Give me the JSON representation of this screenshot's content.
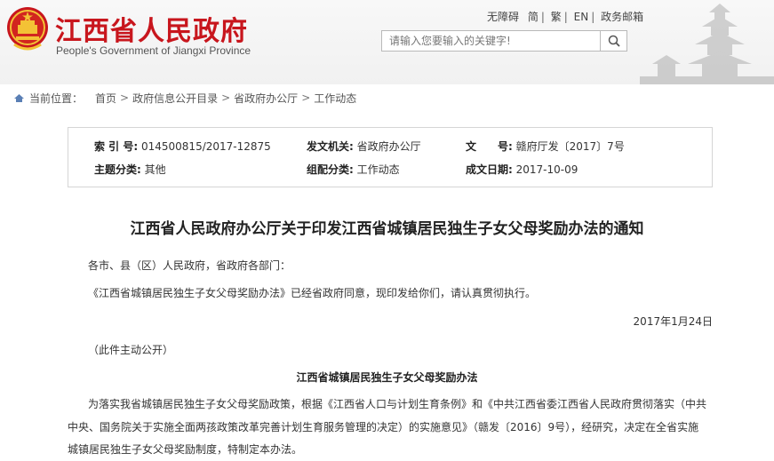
{
  "header": {
    "site_title": "江西省人民政府",
    "site_subtitle": "People's Government of Jiangxi Province",
    "links": [
      "无障碍",
      "简",
      "繁",
      "EN",
      "政务邮箱"
    ],
    "search_placeholder": "请输入您要输入的关键字!"
  },
  "breadcrumb": {
    "label": "当前位置：",
    "items": [
      "首页",
      "政府信息公开目录",
      "省政府办公厅",
      "工作动态"
    ],
    "separator": ">"
  },
  "meta": {
    "index_key": "索 引 号:",
    "index_value": "014500815/2017-12875",
    "issuer_key": "发文机关:",
    "issuer_value": "省政府办公厅",
    "doc_key": "文　　号:",
    "doc_value": "赣府厅发〔2017〕7号",
    "topic_key": "主题分类:",
    "topic_value": "其他",
    "group_key": "组配分类:",
    "group_value": "工作动态",
    "date_key": "成文日期:",
    "date_value": "2017-10-09"
  },
  "article": {
    "title": "江西省人民政府办公厅关于印发江西省城镇居民独生子女父母奖励办法的通知",
    "addressee": "各市、县（区）人民政府，省政府各部门：",
    "body1": "《江西省城镇居民独生子女父母奖励办法》已经省政府同意，现印发给你们，请认真贯彻执行。",
    "date": "2017年1月24日",
    "note": "（此件主动公开）",
    "subtitle": "江西省城镇居民独生子女父母奖励办法",
    "para_lines": [
      "为落实我省城镇居民独生子女父母奖励政策，根据《江西省人口与计划生育条例》和《中共江西省委江西省人民政府贯彻落实（中共",
      "中央、国务院关于实施全面两孩政策改革完善计划生育服务管理的决定）的实施意见》（赣发〔2016〕9号），经研究，决定在全省实施",
      "城镇居民独生子女父母奖励制度，特制定本办法。"
    ]
  },
  "icons": {
    "emblem": "national-emblem-icon",
    "search": "search-icon",
    "home": "home-icon"
  },
  "colors": {
    "brand_red": "#c8161d"
  }
}
